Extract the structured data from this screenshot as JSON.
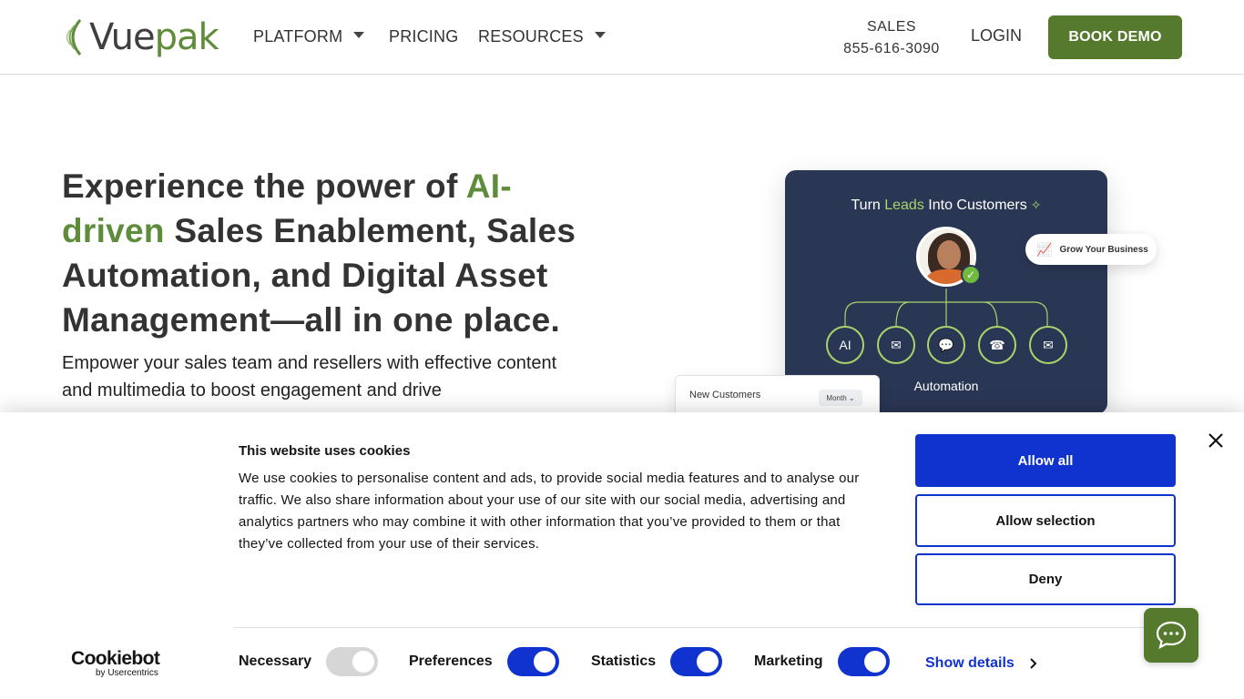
{
  "header": {
    "logo": {
      "part1": "Vue",
      "part2": "pak"
    },
    "nav": {
      "platform": "PLATFORM",
      "pricing": "PRICING",
      "resources": "RESOURCES"
    },
    "sales_label": "SALES",
    "sales_phone": "855-616-3090",
    "login": "LOGIN",
    "book_demo": "BOOK DEMO"
  },
  "hero": {
    "title_1": "Experience the power of ",
    "title_accent": "AI-driven",
    "title_2": " Sales Enablement, Sales Automation, and Digital Asset Management—all in one place.",
    "subtitle": "Empower your sales team and resellers with effective content and multimedia to boost engagement and drive"
  },
  "illustration": {
    "title_pre": "Turn ",
    "title_accent": "Leads",
    "title_post": " Into Customers",
    "nodes": [
      "AI",
      "✉",
      "💬",
      "☎",
      "✉"
    ],
    "automation": "Automation",
    "grow": "Grow Your Business",
    "new_customers": "New Customers",
    "month": "Month"
  },
  "cookie": {
    "title": "This website uses cookies",
    "text": "We use cookies to personalise content and ads, to provide social media features and to analyse our traffic. We also share information about your use of our site with our social media, advertising and analytics partners who may combine it with other information that you’ve provided to them or that they’ve collected from your use of their services.",
    "allow_all": "Allow all",
    "allow_selection": "Allow selection",
    "deny": "Deny",
    "brand": "Cookiebot",
    "brand_sub": "by Usercentrics",
    "toggles": {
      "necessary": {
        "label": "Necessary",
        "on": true,
        "disabled": true
      },
      "preferences": {
        "label": "Preferences",
        "on": true
      },
      "statistics": {
        "label": "Statistics",
        "on": true
      },
      "marketing": {
        "label": "Marketing",
        "on": true
      }
    },
    "show_details": "Show details"
  },
  "colors": {
    "brand_green": "#557a2d",
    "accent_green": "#5e8c3a",
    "cookie_blue": "#1032cf",
    "card_navy": "#2a3754"
  },
  "icons": {
    "close": "close-icon",
    "chat": "chat-icon",
    "chevron": "chevron-right-icon"
  }
}
